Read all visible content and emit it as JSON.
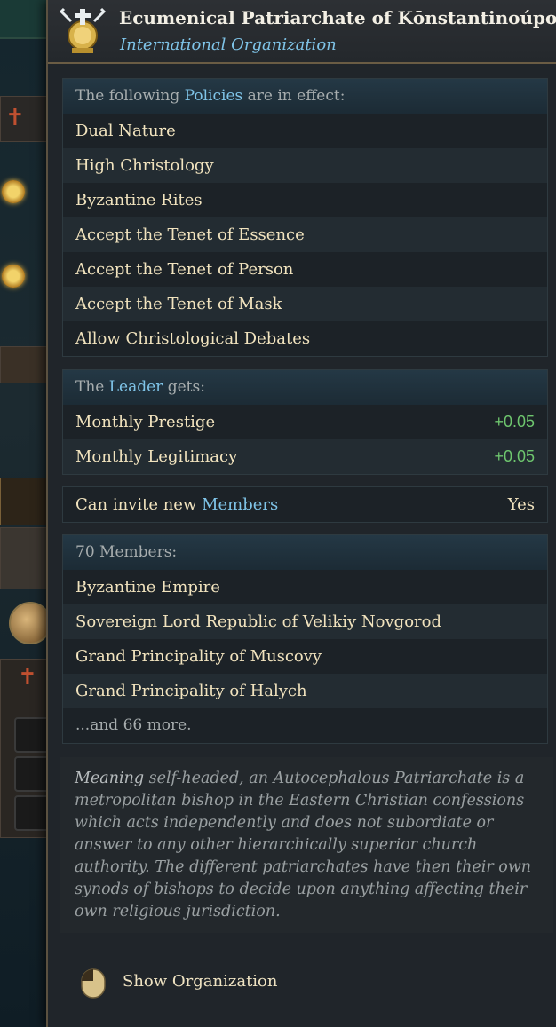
{
  "tooltip": {
    "title": "Ecumenical Patriarchate of Kōnstantinoúpolis",
    "subtitle": "International Organization",
    "icon": "patriarchate-keys-icon"
  },
  "policies": {
    "header_prefix": "The following ",
    "header_highlight": "Policies",
    "header_suffix": " are in effect:",
    "items": [
      "Dual Nature",
      "High Christology",
      "Byzantine Rites",
      "Accept the Tenet of Essence",
      "Accept the Tenet of Person",
      "Accept the Tenet of Mask",
      "Allow Christological Debates"
    ]
  },
  "leader": {
    "header_prefix": "The ",
    "header_highlight": "Leader",
    "header_suffix": " gets:",
    "modifiers": [
      {
        "label": "Monthly Prestige",
        "value": "+0.05"
      },
      {
        "label": "Monthly Legitimacy",
        "value": "+0.05"
      }
    ]
  },
  "invite": {
    "label_prefix": "Can invite new ",
    "label_highlight": "Members",
    "value": "Yes"
  },
  "members": {
    "header": "70 Members:",
    "items": [
      "Byzantine Empire",
      "Sovereign Lord Republic of Velikiy Novgorod",
      "Grand Principality of Muscovy",
      "Grand Principality of Halych"
    ],
    "more": "...and 66 more."
  },
  "description": {
    "lead": "Meaning",
    "lead_plain": " self-headed, ",
    "body": "an Autocephalous Patriarchate is a metropolitan bishop in the Eastern Christian confessions which acts independently and does not subordiate or answer to any other hierarchically superior church authority. The different patriarchates have then their own synods of bishops to decide upon anything affecting their own religious jurisdiction."
  },
  "footer": {
    "action_label": "Show Organization",
    "icon": "mouse-icon"
  },
  "colors": {
    "highlight": "#7fc4e8",
    "positive": "#6ec66e",
    "row_text": "#f1e3be"
  }
}
